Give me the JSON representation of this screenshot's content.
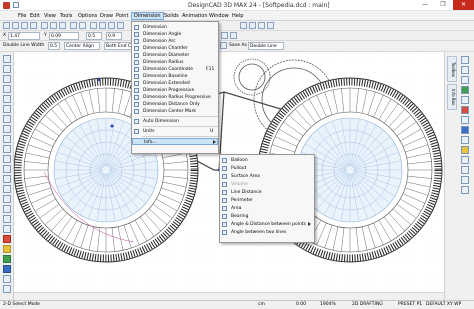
{
  "window": {
    "title": "DesignCAD 3D MAX 24 - [Softpedia.dcd : main]",
    "minimize": "—",
    "maximize": "❐",
    "close": "✕"
  },
  "menubar": {
    "items": [
      "File",
      "Edit",
      "View",
      "Tools",
      "Options",
      "Draw",
      "Point",
      "Dimension",
      "Solids",
      "Animation",
      "Window",
      "Help"
    ],
    "active": "Dimension"
  },
  "toolbar": {
    "coord_x": "1.47",
    "coord_y": "0.09",
    "size_a": "0.5",
    "size_b": "0.9",
    "line_width_label": "Double Line Width",
    "line_width_value": "0.5",
    "align": "Center Align",
    "end_cap": "Both End Ca",
    "save_as": "Save As",
    "line_type": "Double Line"
  },
  "dimension_menu": {
    "items": [
      {
        "label": "Dimension",
        "shortcut": ""
      },
      {
        "label": "Dimension Angle",
        "shortcut": ""
      },
      {
        "label": "Dimension Arc",
        "shortcut": ""
      },
      {
        "label": "Dimension Chamfer",
        "shortcut": ""
      },
      {
        "label": "Dimension Diameter",
        "shortcut": ""
      },
      {
        "label": "Dimension Radius",
        "shortcut": ""
      },
      {
        "label": "Dimension Coordinate",
        "shortcut": "F11"
      },
      {
        "label": "Dimension Baseline",
        "shortcut": ""
      },
      {
        "label": "Dimension Extended",
        "shortcut": ""
      },
      {
        "label": "Dimension Progressive",
        "shortcut": ""
      },
      {
        "label": "Dimension Radius Progressive",
        "shortcut": ""
      },
      {
        "label": "Dimension Distance Only",
        "shortcut": ""
      },
      {
        "label": "Dimension Center Mark",
        "shortcut": ""
      },
      {
        "label": "Auto Dimension",
        "shortcut": ""
      },
      {
        "label": "Units",
        "shortcut": "U"
      },
      {
        "label": "Info...",
        "shortcut": ""
      }
    ]
  },
  "info_submenu": {
    "items": [
      {
        "label": "Balloon",
        "disabled": false
      },
      {
        "label": "Pullout",
        "disabled": false
      },
      {
        "label": "Surface Area",
        "disabled": false
      },
      {
        "label": "Volume",
        "disabled": true
      },
      {
        "label": "Line Distance",
        "disabled": false
      },
      {
        "label": "Perimeter",
        "disabled": false
      },
      {
        "label": "Area",
        "disabled": false
      },
      {
        "label": "Bearing",
        "disabled": false
      },
      {
        "label": "Angle & Distance between points",
        "disabled": false
      },
      {
        "label": "Angle between two lines",
        "disabled": false
      }
    ]
  },
  "right_panel": {
    "tabs": [
      "Toolbox",
      "Info Box"
    ]
  },
  "statusbar": {
    "mode": "2-D Select Mode",
    "units": "cm",
    "value_a": "0.00",
    "value_b": "1904%",
    "drafting": "2D DRAFTING",
    "preset": "PRESET P1",
    "default": "DEFAULT XY WP"
  },
  "colors": {
    "menu_highlight": "#cce4f7",
    "grid_line": "#8fb3d9",
    "selection_handle": "#1f3fbf",
    "status_bar": "#f0f0f0"
  }
}
